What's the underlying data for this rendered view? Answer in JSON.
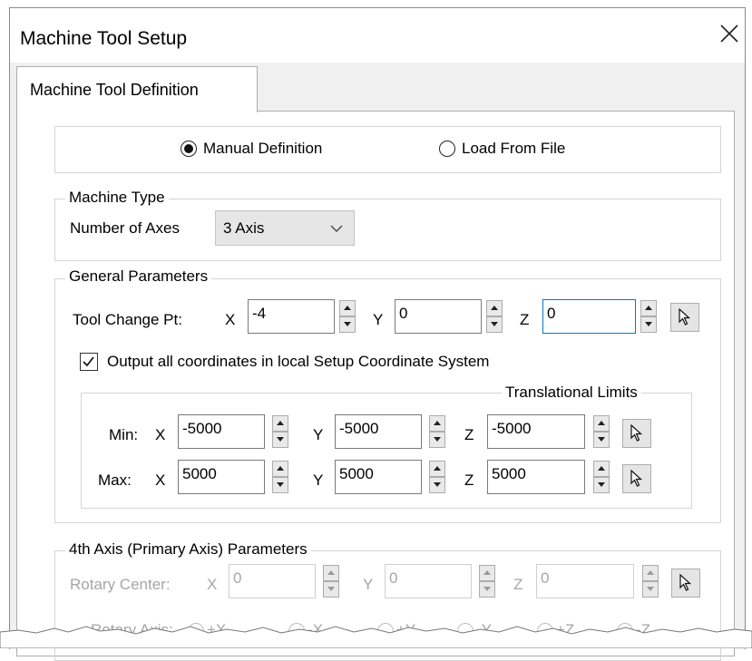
{
  "window": {
    "title": "Machine Tool Setup"
  },
  "tabs": [
    {
      "label": "Machine Tool Definition"
    }
  ],
  "definition": {
    "manual_label": "Manual Definition",
    "file_label": "Load From File",
    "selected": "manual"
  },
  "machine_type": {
    "legend": "Machine Type",
    "axes_label": "Number of Axes",
    "axes_value": "3 Axis"
  },
  "general": {
    "legend": "General Parameters",
    "tool_change_label": "Tool Change Pt:",
    "x_label": "X",
    "y_label": "Y",
    "z_label": "Z",
    "tool_change": {
      "x": "-4",
      "y": "0",
      "z": "0"
    },
    "output_local_label": "Output all coordinates in local Setup Coordinate System",
    "output_local_checked": true,
    "limits": {
      "legend": "Translational Limits",
      "min_label": "Min:",
      "max_label": "Max:",
      "min": {
        "x": "-5000",
        "y": "-5000",
        "z": "-5000"
      },
      "max": {
        "x": "5000",
        "y": "5000",
        "z": "5000"
      }
    }
  },
  "fourth_axis": {
    "legend": "4th Axis (Primary Axis) Parameters",
    "rotary_center_label": "Rotary Center:",
    "rotary_center": {
      "x": "0",
      "y": "0",
      "z": "0"
    },
    "rotary_axis_label": "Rotary Axis:",
    "rotary_axis_options": [
      "+X",
      "-X",
      "+Y",
      "-Y",
      "+Z",
      "-Z"
    ]
  },
  "colors": {
    "focus_border": "#0078d7",
    "disabled_text": "#a6a6a6",
    "panel_bg": "#ffffff",
    "dialog_bg": "#f0f0f0"
  },
  "icons": [
    "close-icon",
    "pointer-select-icon",
    "chevron-down-icon",
    "spin-up-icon",
    "spin-down-icon",
    "checkmark-icon"
  ]
}
